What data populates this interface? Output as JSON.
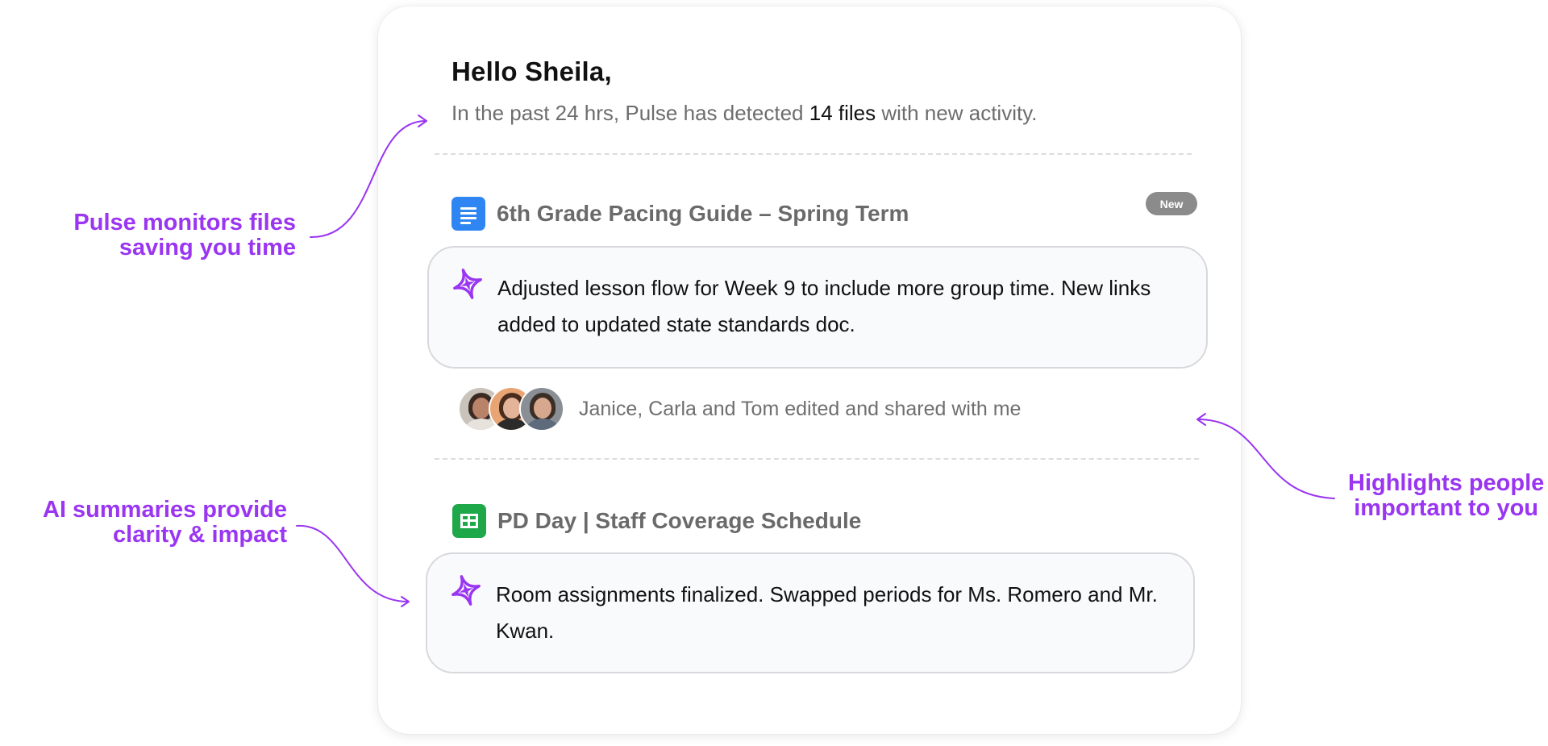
{
  "greeting": "Hello Sheila,",
  "summary_line": {
    "prefix": "In the past 24 hrs, Pulse has detected ",
    "highlight": "14 files",
    "suffix": " with new activity."
  },
  "files": [
    {
      "title": "6th Grade Pacing Guide – Spring Term",
      "icon": "doc-icon",
      "badge": "New",
      "ai_summary": "Adjusted lesson flow for Week 9 to include more group time. New links added to updated state standards doc.",
      "collaborators_text": "Janice, Carla and Tom edited and shared with me"
    },
    {
      "title": "PD Day | Staff Coverage Schedule",
      "icon": "sheet-icon",
      "ai_summary": "Room assignments finalized. Swapped periods for Ms. Romero and Mr. Kwan."
    }
  ],
  "annotations": {
    "monitors": {
      "line1": "Pulse monitors files",
      "line2": "saving you time"
    },
    "summaries": {
      "line1": "AI summaries provide",
      "line2": "clarity & impact"
    },
    "people": {
      "line1": "Highlights people",
      "line2": "important to you"
    }
  },
  "colors": {
    "accent_purple": "#9a35f2",
    "doc_blue": "#2f86f3",
    "sheet_green": "#1ea84a",
    "badge_gray": "#8b8b8b"
  }
}
